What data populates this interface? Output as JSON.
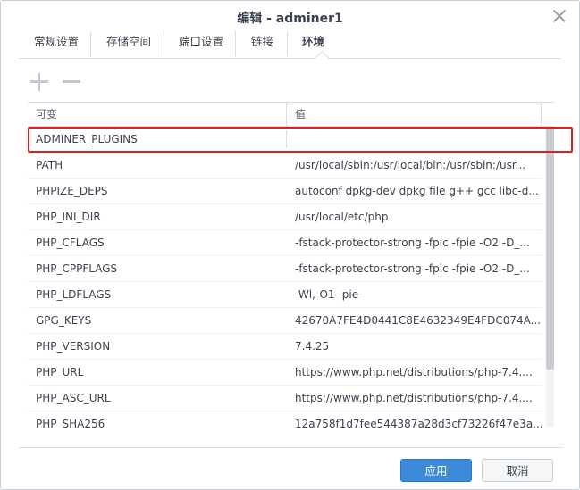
{
  "dialog": {
    "title": "编辑 - adminer1"
  },
  "tabs": [
    {
      "label": "常规设置"
    },
    {
      "label": "存储空间"
    },
    {
      "label": "端口设置"
    },
    {
      "label": "链接"
    },
    {
      "label": "环境",
      "active": true
    }
  ],
  "toolbar": {
    "add_icon": "plus-icon",
    "remove_icon": "minus-icon"
  },
  "table": {
    "columns": [
      "可变",
      "值"
    ],
    "rows": [
      {
        "name": "ADMINER_PLUGINS",
        "value": ""
      },
      {
        "name": "PATH",
        "value": "/usr/local/sbin:/usr/local/bin:/usr/sbin:/usr..."
      },
      {
        "name": "PHPIZE_DEPS",
        "value": "autoconf dpkg-dev dpkg file g++ gcc libc-d..."
      },
      {
        "name": "PHP_INI_DIR",
        "value": "/usr/local/etc/php"
      },
      {
        "name": "PHP_CFLAGS",
        "value": "-fstack-protector-strong -fpic -fpie -O2 -D_..."
      },
      {
        "name": "PHP_CPPFLAGS",
        "value": "-fstack-protector-strong -fpic -fpie -O2 -D_..."
      },
      {
        "name": "PHP_LDFLAGS",
        "value": "-Wl,-O1 -pie"
      },
      {
        "name": "GPG_KEYS",
        "value": "42670A7FE4D0441C8E4632349E4FDC074A..."
      },
      {
        "name": "PHP_VERSION",
        "value": "7.4.25"
      },
      {
        "name": "PHP_URL",
        "value": "https://www.php.net/distributions/php-7.4...."
      },
      {
        "name": "PHP_ASC_URL",
        "value": "https://www.php.net/distributions/php-7.4...."
      },
      {
        "name": "PHP_SHA256",
        "value": "12a758f1d7fee544387a28d3cf73226f47e3a..."
      }
    ]
  },
  "buttons": {
    "apply": "应用",
    "cancel": "取消"
  },
  "colors": {
    "highlight": "#e02020",
    "primary": "#3d8ad9"
  }
}
